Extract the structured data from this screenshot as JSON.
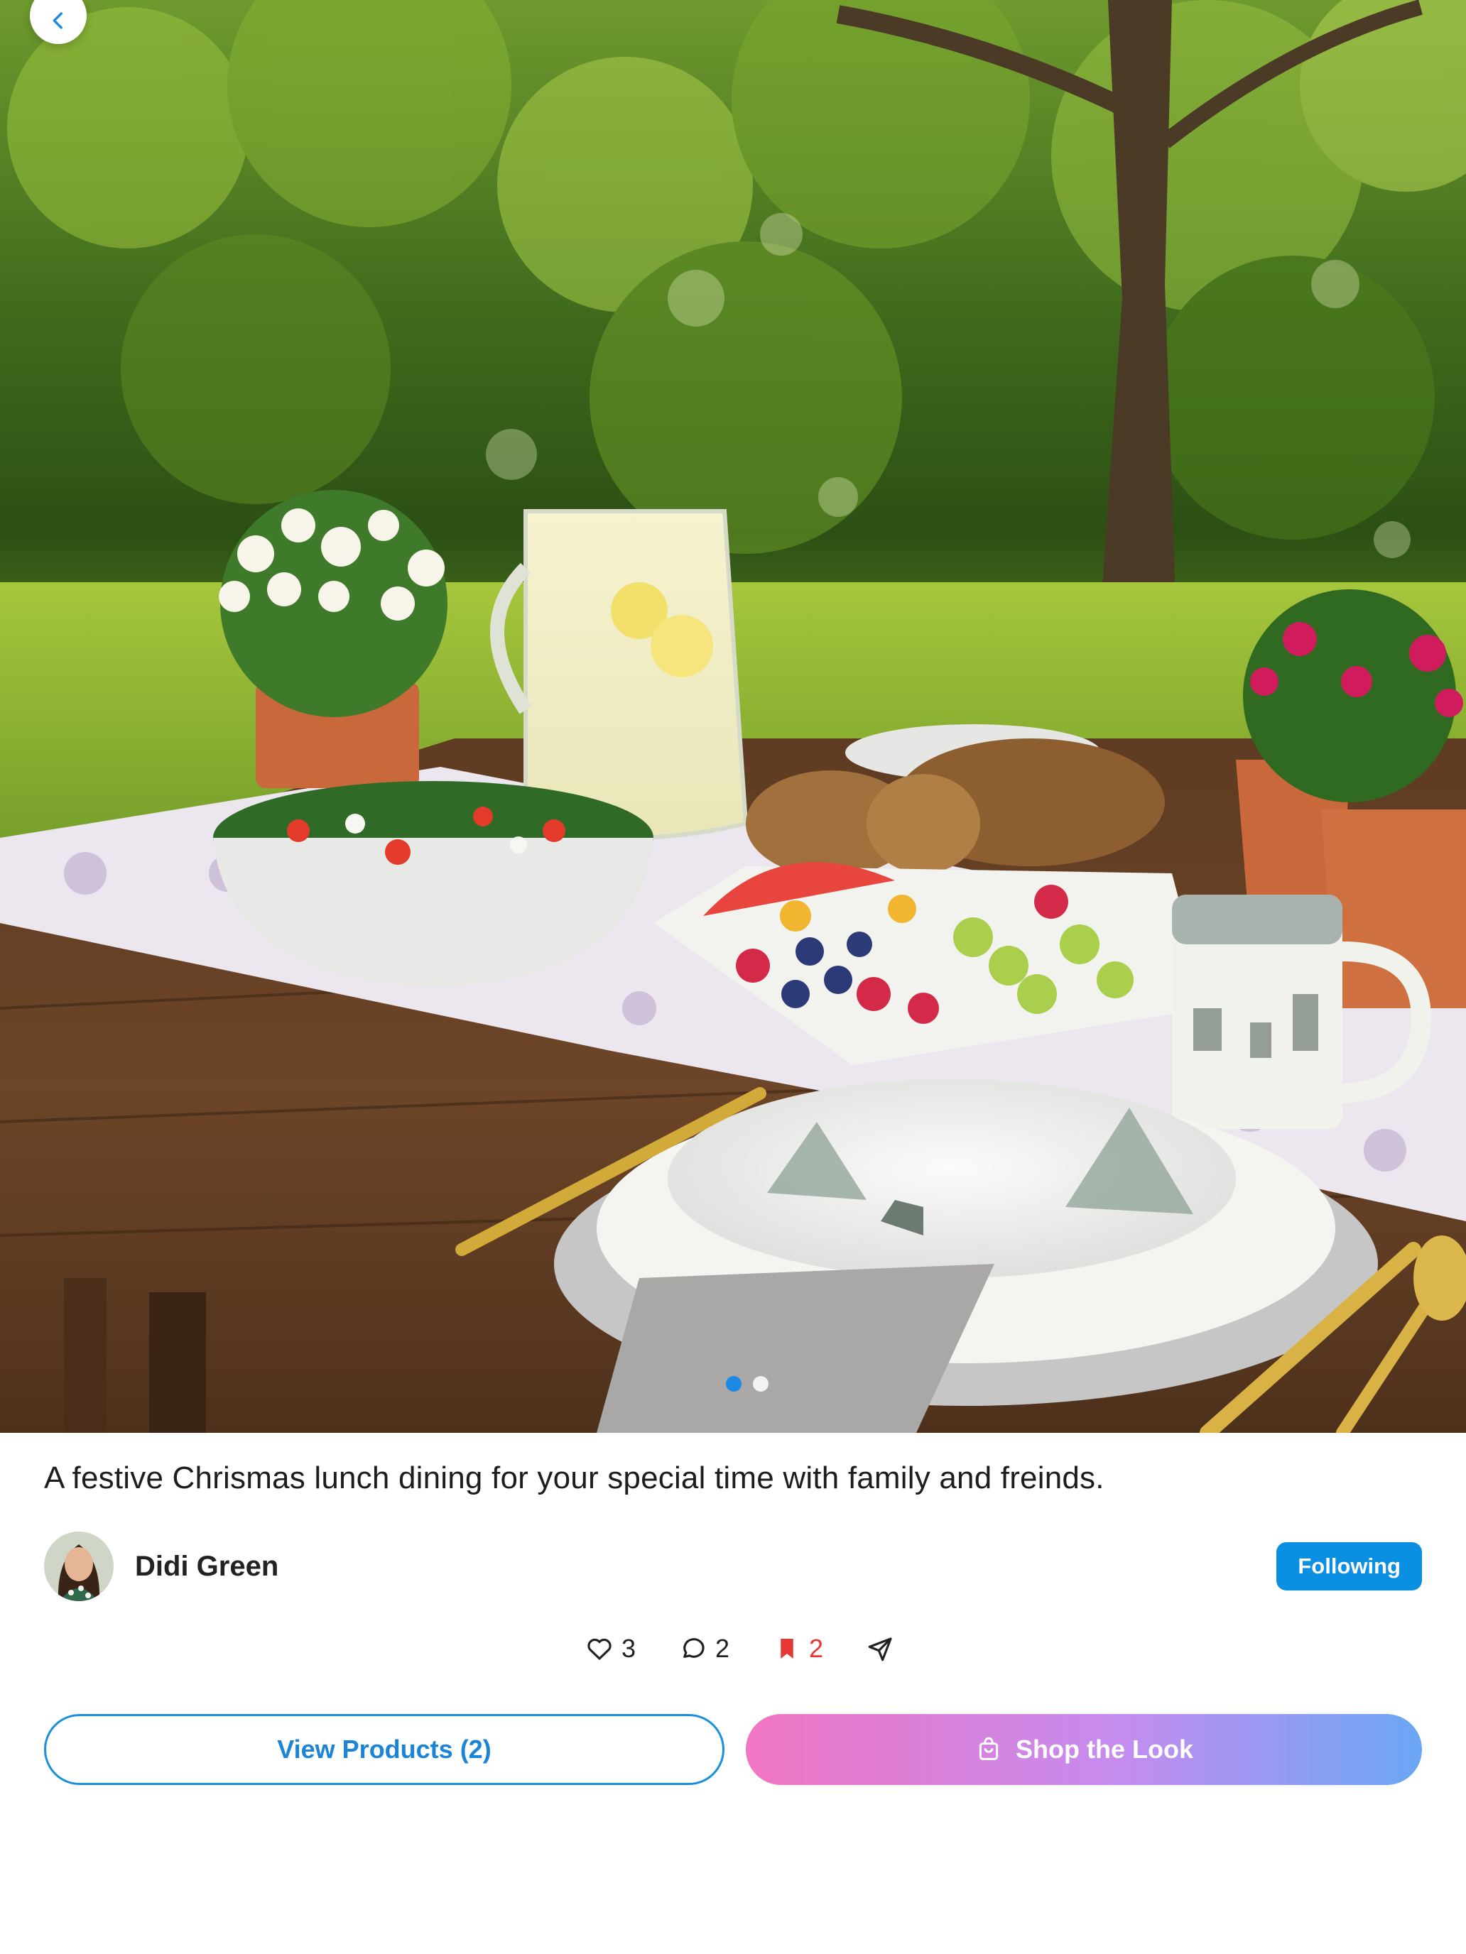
{
  "nav": {
    "back_icon": "chevron-left-icon"
  },
  "carousel": {
    "slide_count": 2,
    "active_index": 0,
    "active_color": "#1e88e5"
  },
  "post": {
    "caption": "A festive Chrismas lunch dining for your special time with family and freinds."
  },
  "author": {
    "name": "Didi Green",
    "follow_label": "Following",
    "follow_color": "#0a8fe3"
  },
  "actions": {
    "likes": "3",
    "comments": "2",
    "saves": "2",
    "saved_color": "#e53935",
    "icons": [
      "heart-icon",
      "comment-icon",
      "bookmark-icon",
      "send-icon"
    ]
  },
  "buttons": {
    "view_products": "View Products (2)",
    "shop_the_look": "Shop the Look",
    "shop_icon": "shopping-bag-icon"
  }
}
